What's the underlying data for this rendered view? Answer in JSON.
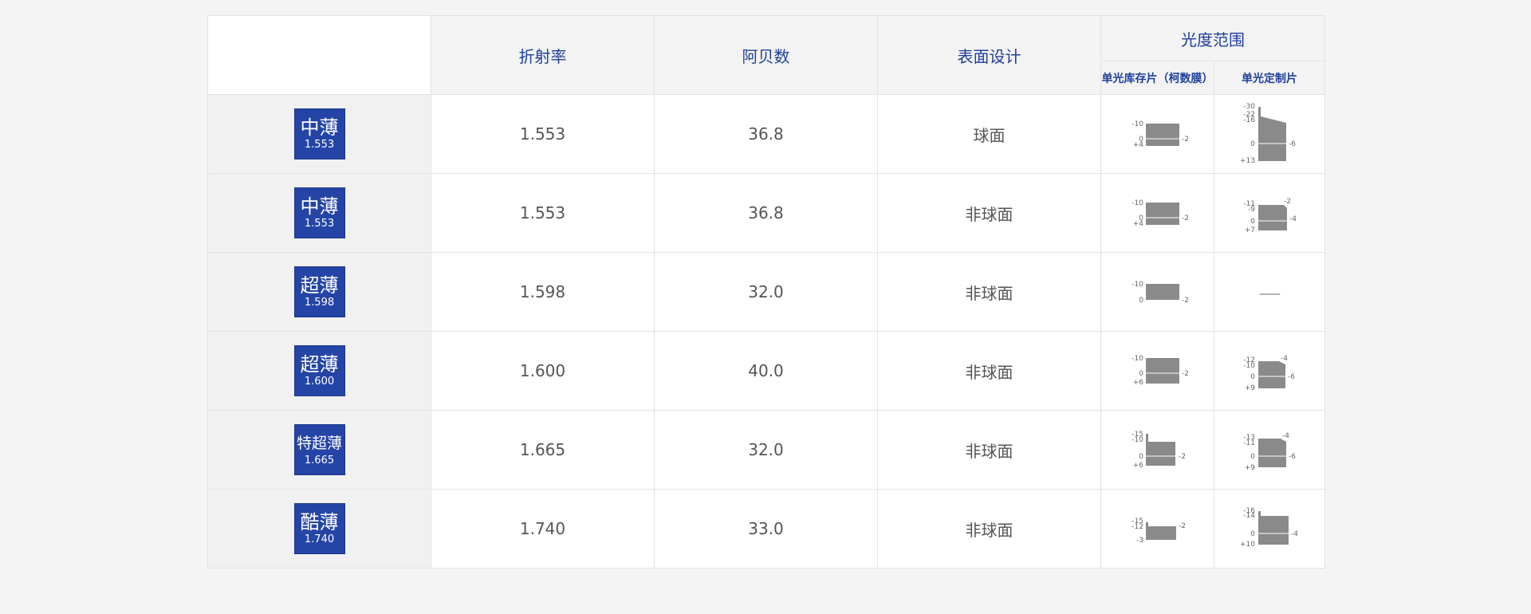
{
  "header": {
    "refractive_index": "折射率",
    "abbe_number": "阿贝数",
    "surface_design": "表面设计",
    "power_range": "光度范围",
    "stock_lens": "单光库存片（柯数膜）",
    "custom_lens": "单光定制片"
  },
  "rows": [
    {
      "name": "中薄",
      "index_label": "1.553",
      "refractive_index": "1.553",
      "abbe": "36.8",
      "surface": "球面",
      "stock": {
        "labels_left": [
          "-10",
          "0",
          "+4"
        ],
        "labels_right": [
          "-2"
        ]
      },
      "custom": {
        "labels_left": [
          "-30",
          "-22",
          "-16",
          "0",
          "+13"
        ],
        "labels_right": [
          "-6"
        ]
      }
    },
    {
      "name": "中薄",
      "index_label": "1.553",
      "refractive_index": "1.553",
      "abbe": "36.8",
      "surface": "非球面",
      "stock": {
        "labels_left": [
          "-10",
          "0",
          "+4"
        ],
        "labels_right": [
          "-2"
        ]
      },
      "custom": {
        "labels_left": [
          "-11",
          "-9",
          "0",
          "+7"
        ],
        "labels_right": [
          "-2",
          "-4"
        ]
      }
    },
    {
      "name": "超薄",
      "index_label": "1.598",
      "refractive_index": "1.598",
      "abbe": "32.0",
      "surface": "非球面",
      "stock": {
        "labels_left": [
          "-10",
          "0"
        ],
        "labels_right": [
          "-2"
        ]
      },
      "custom": {
        "none": "——"
      }
    },
    {
      "name": "超薄",
      "index_label": "1.600",
      "refractive_index": "1.600",
      "abbe": "40.0",
      "surface": "非球面",
      "stock": {
        "labels_left": [
          "-10",
          "0",
          "+6"
        ],
        "labels_right": [
          "-2"
        ]
      },
      "custom": {
        "labels_left": [
          "-12",
          "-10",
          "0",
          "+9"
        ],
        "labels_right": [
          "-4",
          "-6"
        ]
      }
    },
    {
      "name": "特超薄",
      "index_label": "1.665",
      "refractive_index": "1.665",
      "abbe": "32.0",
      "surface": "非球面",
      "stock": {
        "labels_left": [
          "-15",
          "-10",
          "0",
          "+6"
        ],
        "labels_right": [
          "-2"
        ]
      },
      "custom": {
        "labels_left": [
          "-13",
          "-11",
          "0",
          "+9"
        ],
        "labels_right": [
          "-4",
          "-6"
        ]
      }
    },
    {
      "name": "酷薄",
      "index_label": "1.740",
      "refractive_index": "1.740",
      "abbe": "33.0",
      "surface": "非球面",
      "stock": {
        "labels_left": [
          "-15",
          "-12",
          "-3"
        ],
        "labels_right": [
          "-2"
        ]
      },
      "custom": {
        "labels_left": [
          "-16",
          "-14",
          "0",
          "+10"
        ],
        "labels_right": [
          "-4"
        ]
      }
    }
  ]
}
